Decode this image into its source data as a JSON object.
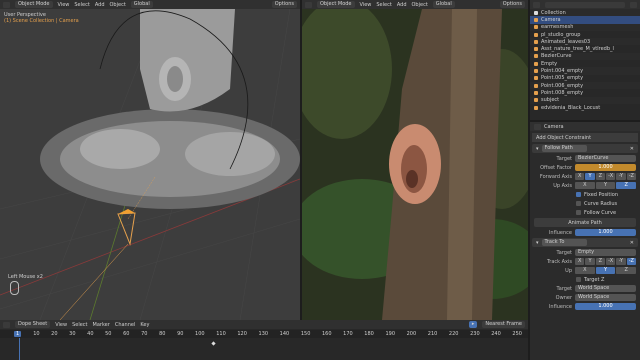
{
  "left_viewport": {
    "mode": "Object Mode",
    "menus": [
      "View",
      "Select",
      "Add",
      "Object"
    ],
    "orientation": "Global",
    "options_label": "Options",
    "view_name": "User Perspective",
    "collection_label": "(1) Scene Collection | Camera",
    "status_text": "Left Mouse x2"
  },
  "right_viewport": {
    "mode": "Object Mode",
    "menus": [
      "View",
      "Select",
      "Add",
      "Object"
    ],
    "orientation": "Global",
    "options_label": "Options"
  },
  "outliner": {
    "items": [
      {
        "label": "Collection",
        "color": "#ffffff"
      },
      {
        "label": "Camera",
        "color": "#e5a04d"
      },
      {
        "label": "earmesmesh",
        "color": "#e5a04d"
      },
      {
        "label": "pl_studio_group",
        "color": "#e5a04d"
      },
      {
        "label": "Animated_leaves03",
        "color": "#e5a04d"
      },
      {
        "label": "Asst_nature_tree_M_vtlredb_l",
        "color": "#e5a04d"
      },
      {
        "label": "BezierCurve",
        "color": "#e5a04d"
      },
      {
        "label": "Empty",
        "color": "#e5a04d"
      },
      {
        "label": "Point.004_empty",
        "color": "#e5a04d"
      },
      {
        "label": "Point.005_empty",
        "color": "#e5a04d"
      },
      {
        "label": "Point.006_empty",
        "color": "#e5a04d"
      },
      {
        "label": "Point.008_empty",
        "color": "#e5a04d"
      },
      {
        "label": "subject",
        "color": "#e5a04d"
      },
      {
        "label": "edvidenia_Black_Locust",
        "color": "#e5a04d"
      }
    ]
  },
  "properties": {
    "object_name": "Camera",
    "add_constraint": "Add Object Constraint",
    "follow_path": {
      "name": "Follow Path",
      "target_label": "Target",
      "target_value": "BezierCurve",
      "offset_label": "Offset Factor",
      "offset_value": "1.000",
      "forward_label": "Forward Axis",
      "forward_axes": [
        "X",
        "Y",
        "Z",
        "-X",
        "-Y",
        "-Z"
      ],
      "up_label": "Up Axis",
      "up_axes": [
        "X",
        "Y",
        "Z"
      ],
      "fixed_position": "Fixed Position",
      "curve_radius": "Curve Radius",
      "follow_curve": "Follow Curve",
      "animate_path": "Animate Path",
      "influence_label": "Influence",
      "influence_value": "1.000"
    },
    "track_to": {
      "name": "Track To",
      "target_label": "Target",
      "target_value": "Empty",
      "track_label": "Track Axis",
      "track_axes": [
        "X",
        "Y",
        "Z",
        "-X",
        "-Y",
        "-Z"
      ],
      "up_label": "Up",
      "up_axes": [
        "X",
        "Y",
        "Z"
      ],
      "target_z": "Target Z",
      "target_space_label": "Target",
      "target_space_value": "World Space",
      "owner_label": "Owner",
      "owner_value": "World Space",
      "influence_label": "Influence",
      "influence_value": "1.000"
    }
  },
  "dope_sheet": {
    "editor": "Dope Sheet",
    "menus": [
      "View",
      "Select",
      "Marker",
      "Channel",
      "Key"
    ],
    "interpolation": "Nearest Frame",
    "current_frame": "1",
    "frame_ticks": [
      "10",
      "20",
      "30",
      "40",
      "50",
      "60",
      "70",
      "80",
      "90",
      "100",
      "110",
      "120",
      "130",
      "140",
      "150",
      "160",
      "170",
      "180",
      "190",
      "200",
      "210",
      "220",
      "230",
      "240",
      "250"
    ]
  }
}
